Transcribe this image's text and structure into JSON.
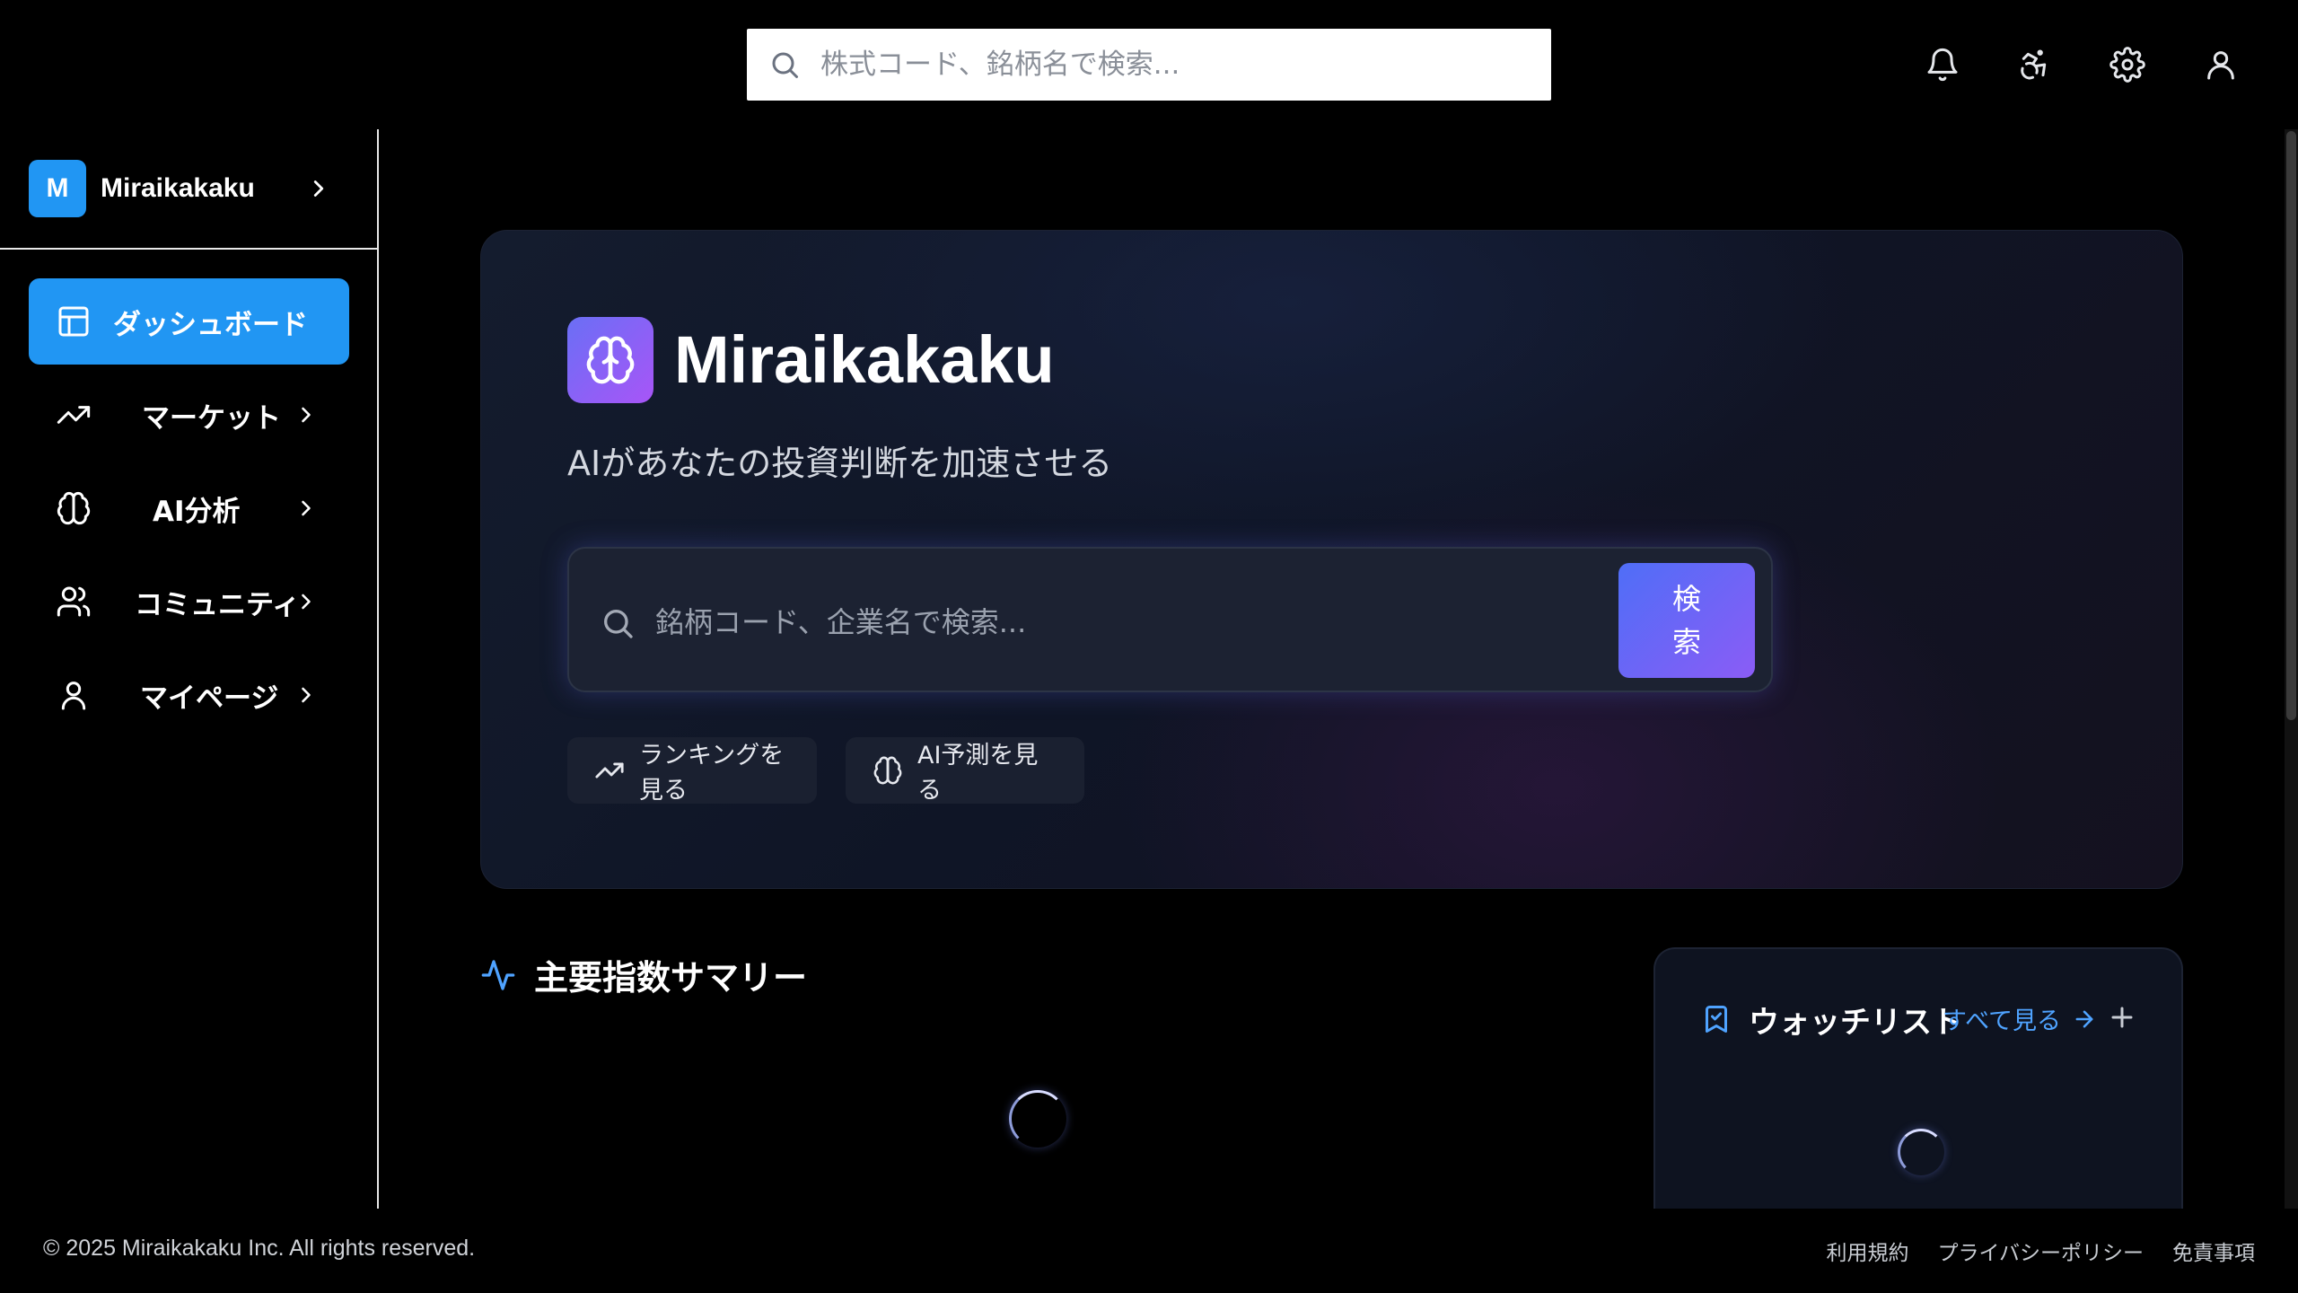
{
  "topbar": {
    "search_placeholder": "株式コード、銘柄名で検索...",
    "icons": [
      "bell-icon",
      "accessibility-icon",
      "settings-icon",
      "user-icon"
    ]
  },
  "sidebar": {
    "brand_initial": "M",
    "brand_name": "Miraikakaku",
    "items": [
      {
        "label": "ダッシュボード",
        "icon": "layout-icon",
        "active": true
      },
      {
        "label": "マーケット",
        "icon": "trending-up-icon"
      },
      {
        "label": "AI分析",
        "icon": "brain-icon"
      },
      {
        "label": "コミュニティ",
        "icon": "users-icon"
      },
      {
        "label": "マイページ",
        "icon": "user-icon"
      }
    ]
  },
  "hero": {
    "title": "Miraikakaku",
    "subtitle": "AIがあなたの投資判断を加速させる",
    "search_placeholder": "銘柄コード、企業名で検索...",
    "search_button": "検索",
    "pills": [
      {
        "label": "ランキングを見る",
        "icon": "trending-up-icon"
      },
      {
        "label": "AI予測を見る",
        "icon": "brain-icon"
      }
    ]
  },
  "summary": {
    "title": "主要指数サマリー"
  },
  "watchlist": {
    "title": "ウォッチリスト",
    "view_all": "すべて見る"
  },
  "footer": {
    "copyright": "© 2025 Miraikakaku Inc. All rights reserved.",
    "links": [
      "利用規約",
      "プライバシーポリシー",
      "免責事項"
    ]
  },
  "colors": {
    "accent": "#2196f3",
    "brand_gradient_start": "#6a6ff5",
    "brand_gradient_end": "#a855f7",
    "link": "#4fa3ff"
  }
}
